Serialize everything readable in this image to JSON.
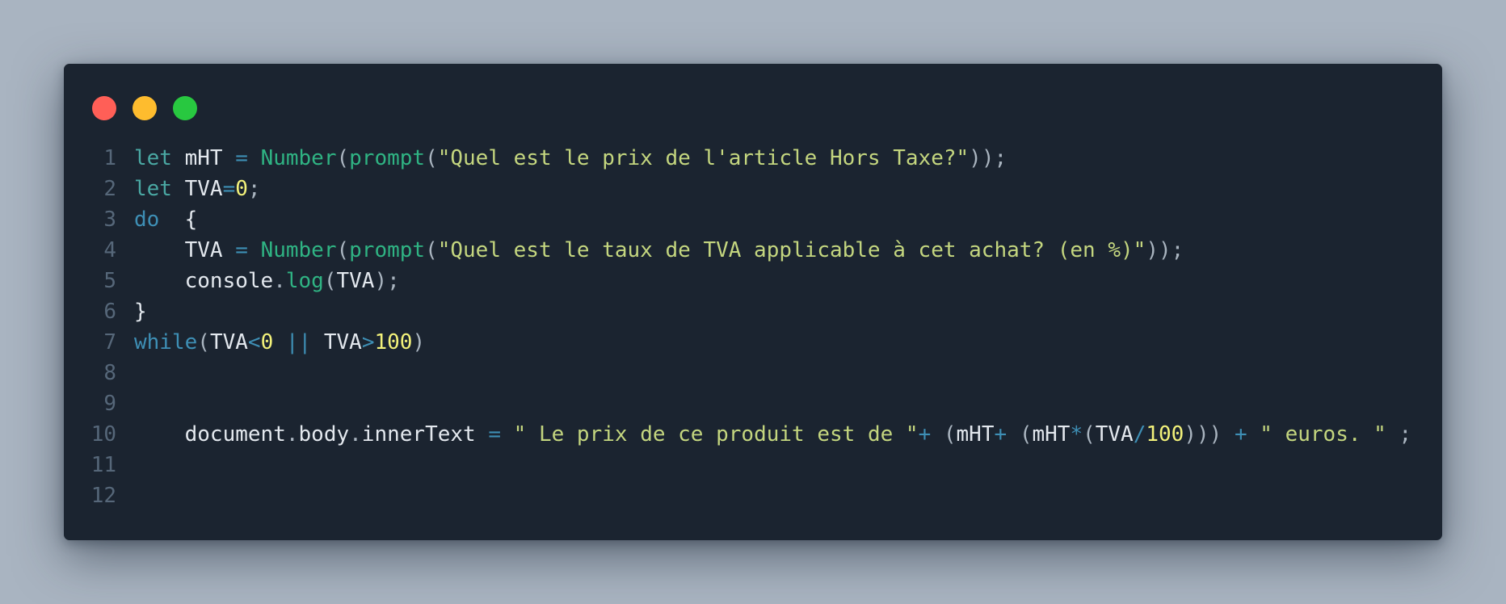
{
  "window": {
    "controls": [
      {
        "name": "close",
        "color": "#ff5f57"
      },
      {
        "name": "minimize",
        "color": "#febc2e"
      },
      {
        "name": "zoom",
        "color": "#28c840"
      }
    ]
  },
  "code": {
    "language": "javascript",
    "lines": [
      {
        "number": "1",
        "tokens": [
          {
            "t": "let",
            "k": "kw"
          },
          {
            "t": " ",
            "k": "ws"
          },
          {
            "t": "mHT",
            "k": "id"
          },
          {
            "t": " ",
            "k": "ws"
          },
          {
            "t": "=",
            "k": "op"
          },
          {
            "t": " ",
            "k": "ws"
          },
          {
            "t": "Number",
            "k": "fn"
          },
          {
            "t": "(",
            "k": "punc"
          },
          {
            "t": "prompt",
            "k": "fn"
          },
          {
            "t": "(",
            "k": "punc"
          },
          {
            "t": "\"Quel est le prix de l'article Hors Taxe?\"",
            "k": "str"
          },
          {
            "t": "));",
            "k": "punc"
          }
        ]
      },
      {
        "number": "2",
        "tokens": [
          {
            "t": "let",
            "k": "kw"
          },
          {
            "t": " ",
            "k": "ws"
          },
          {
            "t": "TVA",
            "k": "id"
          },
          {
            "t": "=",
            "k": "op"
          },
          {
            "t": "0",
            "k": "num"
          },
          {
            "t": ";",
            "k": "punc"
          }
        ]
      },
      {
        "number": "3",
        "tokens": [
          {
            "t": "do",
            "k": "ctrl"
          },
          {
            "t": "  ",
            "k": "ws"
          },
          {
            "t": "{",
            "k": "id"
          }
        ]
      },
      {
        "number": "4",
        "tokens": [
          {
            "t": "    ",
            "k": "ws"
          },
          {
            "t": "TVA",
            "k": "id"
          },
          {
            "t": " ",
            "k": "ws"
          },
          {
            "t": "=",
            "k": "op"
          },
          {
            "t": " ",
            "k": "ws"
          },
          {
            "t": "Number",
            "k": "fn"
          },
          {
            "t": "(",
            "k": "punc"
          },
          {
            "t": "prompt",
            "k": "fn"
          },
          {
            "t": "(",
            "k": "punc"
          },
          {
            "t": "\"Quel est le taux de TVA applicable à cet achat? (en %)\"",
            "k": "str"
          },
          {
            "t": "));",
            "k": "punc"
          }
        ]
      },
      {
        "number": "5",
        "tokens": [
          {
            "t": "    ",
            "k": "ws"
          },
          {
            "t": "console",
            "k": "id"
          },
          {
            "t": ".",
            "k": "punc"
          },
          {
            "t": "log",
            "k": "fn"
          },
          {
            "t": "(",
            "k": "punc"
          },
          {
            "t": "TVA",
            "k": "id"
          },
          {
            "t": ");",
            "k": "punc"
          }
        ]
      },
      {
        "number": "6",
        "tokens": [
          {
            "t": "}",
            "k": "id"
          }
        ]
      },
      {
        "number": "7",
        "tokens": [
          {
            "t": "while",
            "k": "ctrl"
          },
          {
            "t": "(",
            "k": "punc"
          },
          {
            "t": "TVA",
            "k": "id"
          },
          {
            "t": "<",
            "k": "op"
          },
          {
            "t": "0",
            "k": "num"
          },
          {
            "t": " ",
            "k": "ws"
          },
          {
            "t": "||",
            "k": "op"
          },
          {
            "t": " ",
            "k": "ws"
          },
          {
            "t": "TVA",
            "k": "id"
          },
          {
            "t": ">",
            "k": "op"
          },
          {
            "t": "100",
            "k": "num"
          },
          {
            "t": ")",
            "k": "punc"
          }
        ]
      },
      {
        "number": "8",
        "tokens": []
      },
      {
        "number": "9",
        "tokens": []
      },
      {
        "number": "10",
        "tokens": [
          {
            "t": "    ",
            "k": "ws"
          },
          {
            "t": "document",
            "k": "id"
          },
          {
            "t": ".",
            "k": "punc"
          },
          {
            "t": "body",
            "k": "id"
          },
          {
            "t": ".",
            "k": "punc"
          },
          {
            "t": "innerText",
            "k": "id"
          },
          {
            "t": " ",
            "k": "ws"
          },
          {
            "t": "=",
            "k": "op"
          },
          {
            "t": " ",
            "k": "ws"
          },
          {
            "t": "\" Le prix de ce produit est de \"",
            "k": "str"
          },
          {
            "t": "+",
            "k": "op"
          },
          {
            "t": " ",
            "k": "ws"
          },
          {
            "t": "(",
            "k": "punc"
          },
          {
            "t": "mHT",
            "k": "id"
          },
          {
            "t": "+",
            "k": "op"
          },
          {
            "t": " ",
            "k": "ws"
          },
          {
            "t": "(",
            "k": "punc"
          },
          {
            "t": "mHT",
            "k": "id"
          },
          {
            "t": "*",
            "k": "op"
          },
          {
            "t": "(",
            "k": "punc"
          },
          {
            "t": "TVA",
            "k": "id"
          },
          {
            "t": "/",
            "k": "op"
          },
          {
            "t": "100",
            "k": "num"
          },
          {
            "t": ")))",
            "k": "punc"
          },
          {
            "t": " ",
            "k": "ws"
          },
          {
            "t": "+",
            "k": "op"
          },
          {
            "t": " ",
            "k": "ws"
          },
          {
            "t": "\" euros. \"",
            "k": "str"
          },
          {
            "t": " ",
            "k": "ws"
          },
          {
            "t": ";",
            "k": "punc"
          }
        ]
      },
      {
        "number": "11",
        "tokens": []
      },
      {
        "number": "12",
        "tokens": []
      }
    ]
  }
}
